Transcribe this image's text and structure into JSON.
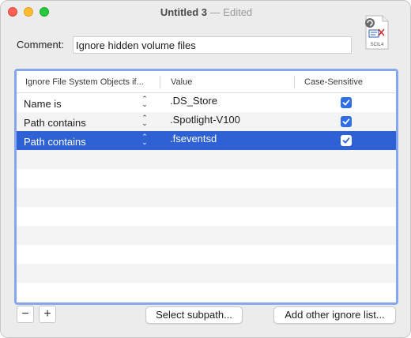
{
  "window": {
    "title": "Untitled 3",
    "separator": "—",
    "status": "Edited"
  },
  "document_icon": {
    "label": "SCIL4"
  },
  "comment": {
    "label": "Comment:",
    "value": "Ignore hidden volume files"
  },
  "table": {
    "columns": [
      "Ignore File System Objects if...",
      "Value",
      "Case-Sensitive"
    ],
    "rows": [
      {
        "condition": "Name is",
        "value": ".DS_Store",
        "case_sensitive": true,
        "selected": false
      },
      {
        "condition": "Path contains",
        "value": ".Spotlight-V100",
        "case_sensitive": true,
        "selected": false
      },
      {
        "condition": "Path contains",
        "value": ".fseventsd",
        "case_sensitive": true,
        "selected": true
      }
    ],
    "empty_rows": 8
  },
  "buttons": {
    "remove": "−",
    "add": "+",
    "select_subpath": "Select subpath...",
    "add_other": "Add other ignore list..."
  },
  "colors": {
    "selection": "#2d61d4",
    "focus_ring": "#86a7ee",
    "checkbox": "#2d6ee6"
  }
}
